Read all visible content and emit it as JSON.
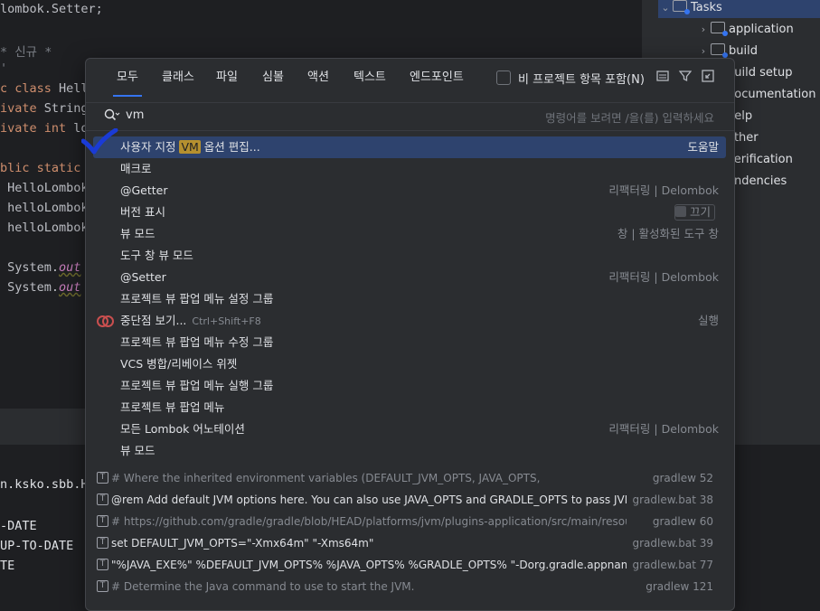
{
  "editor": {
    "lines": [
      {
        "parts": [
          {
            "t": "lombok.Setter;",
            "c": ""
          }
        ]
      },
      {
        "parts": [
          {
            "t": "* 신규 *",
            "c": "comment"
          }
        ]
      },
      {
        "parts": [
          {
            "t": "'",
            "c": "comment"
          }
        ]
      },
      {
        "parts": [
          {
            "t": "c class ",
            "c": "kw"
          },
          {
            "t": "HelloL",
            "c": ""
          }
        ]
      },
      {
        "parts": [
          {
            "t": "ivate ",
            "c": "kw"
          },
          {
            "t": "String",
            "c": ""
          }
        ]
      },
      {
        "parts": [
          {
            "t": "ivate int ",
            "c": "kw"
          },
          {
            "t": "lon",
            "c": ""
          }
        ]
      },
      {
        "parts": [
          {
            "t": "blic static v",
            "c": "kw"
          }
        ]
      },
      {
        "parts": [
          {
            "t": " HelloLombok",
            "c": ""
          }
        ]
      },
      {
        "parts": [
          {
            "t": " helloLombok",
            "c": ""
          }
        ]
      },
      {
        "parts": [
          {
            "t": " helloLombok",
            "c": ""
          }
        ]
      },
      {
        "parts": [
          {
            "t": " System.",
            "c": ""
          },
          {
            "t": "out",
            "c": "ital"
          }
        ]
      },
      {
        "parts": [
          {
            "t": " System.",
            "c": ""
          },
          {
            "t": "out",
            "c": "ital"
          }
        ]
      }
    ]
  },
  "project_tree": {
    "items": [
      {
        "label": "Tasks",
        "expanded": true,
        "selected": true
      },
      {
        "label": "application",
        "expanded": false
      },
      {
        "label": "build",
        "expanded": false
      },
      {
        "label": "build setup"
      },
      {
        "label": "documentation"
      },
      {
        "label": "help"
      },
      {
        "label": "other"
      },
      {
        "label": "verification"
      },
      {
        "label": "endencies"
      }
    ]
  },
  "run_panel": {
    "lines": [
      "n.ksko.sbb.He",
      "",
      "-DATE",
      "UP-TO-DATE",
      "TE"
    ]
  },
  "popup": {
    "tabs": [
      "모두",
      "클래스",
      "파일",
      "심볼",
      "액션",
      "텍스트",
      "엔드포인트"
    ],
    "active_tab": "모두",
    "include_non_project_label": "비 프로젝트 항목 포함(N)",
    "search": {
      "value": "vm",
      "hint": "명령어를 보려면 /을(를) 입력하세요"
    },
    "results": [
      {
        "pre": "사용자 지정 ",
        "match": "VM",
        "post": " 옵션 편집...",
        "right": "도움말",
        "selected": true
      },
      {
        "pre": "매크로",
        "right": ""
      },
      {
        "pre": "@Getter",
        "right": "리팩터링 | Delombok"
      },
      {
        "pre": "버전 표시",
        "right": "끄기",
        "toggle": true
      },
      {
        "pre": "뷰 모드",
        "right": "창 | 활성화된 도구 창"
      },
      {
        "pre": "도구 창 뷰 모드",
        "right": ""
      },
      {
        "pre": "@Setter",
        "right": "리팩터링 | Delombok"
      },
      {
        "pre": "프로젝트 뷰 팝업 메뉴 설정 그룹",
        "right": ""
      },
      {
        "pre": "중단점 보기...",
        "shortcut": "Ctrl+Shift+F8",
        "right": "실행",
        "breakpoint": true
      },
      {
        "pre": "프로젝트 뷰 팝업 메뉴 수정 그룹",
        "right": ""
      },
      {
        "pre": "VCS 병합/리베이스 위젯",
        "right": ""
      },
      {
        "pre": "프로젝트 뷰 팝업 메뉴 실행 그룹",
        "right": ""
      },
      {
        "pre": "프로젝트 뷰 팝업 메뉴",
        "right": ""
      },
      {
        "pre": "모든 Lombok 어노테이션",
        "right": "리팩터링 | Delombok"
      },
      {
        "pre": "뷰 모드",
        "right": ""
      }
    ],
    "text_results": [
      {
        "text": "#        Where the inherited environment variables (DEFAULT_JVM_OPTS, JAVA_OPTS,",
        "dim": true,
        "file": "gradlew 52"
      },
      {
        "text": "@rem Add default JVM options here. You can also use JAVA_OPTS and GRADLE_OPTS to pass JVM optio",
        "dim": false,
        "file": "gradlew.bat 38"
      },
      {
        "text": "#        https://github.com/gradle/gradle/blob/HEAD/platforms/jvm/plugins-application/src/main/resources/or",
        "dim": true,
        "file": "gradlew 60"
      },
      {
        "text": "set DEFAULT_JVM_OPTS=\"-Xmx64m\" \"-Xms64m\"",
        "dim": false,
        "file": "gradlew.bat 39"
      },
      {
        "text": "\"%JAVA_EXE%\" %DEFAULT_JVM_OPTS% %JAVA_OPTS% %GRADLE_OPTS% \"-Dorg.gradle.appname=%API",
        "dim": false,
        "file": "gradlew.bat 77"
      },
      {
        "text": "# Determine the Java command to use to start the JVM.",
        "dim": true,
        "file": "gradlew 121"
      }
    ]
  },
  "colors": {
    "accent": "#3574f0",
    "match_highlight": "#b5902f",
    "selection": "#2e436e",
    "annotation_check": "#1a3bd6"
  }
}
